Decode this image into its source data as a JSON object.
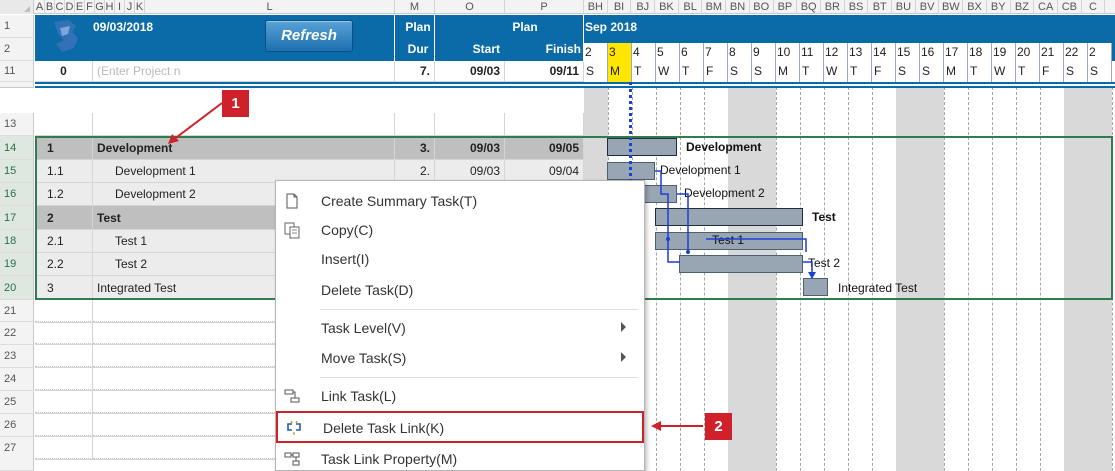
{
  "column_letters": [
    "A",
    "B",
    "C",
    "D",
    "E",
    "F",
    "G",
    "H",
    "I",
    "J",
    "K",
    "L",
    "M",
    "O",
    "P",
    "BH",
    "BI",
    "BJ",
    "BK",
    "BL",
    "BM",
    "BN",
    "BO",
    "BP",
    "BQ",
    "BR",
    "BS",
    "BT",
    "BU",
    "BV",
    "BW",
    "BX",
    "BY",
    "BZ",
    "CA",
    "CB",
    "C"
  ],
  "row_numbers": [
    "1",
    "2",
    "11",
    "13",
    "14",
    "15",
    "16",
    "17",
    "18",
    "19",
    "20",
    "21",
    "22",
    "23",
    "24",
    "25",
    "26",
    "27"
  ],
  "header": {
    "date": "09/03/2018",
    "refresh_label": "Refresh",
    "plan_label": "Plan",
    "dur_label": "Dur",
    "plan_group_label": "Plan",
    "start_label": "Start",
    "finish_label": "Finish",
    "month_label": "Sep 2018",
    "day_numbers": [
      "2",
      "3",
      "4",
      "5",
      "6",
      "7",
      "8",
      "9",
      "10",
      "11",
      "12",
      "13",
      "14",
      "15",
      "16",
      "17",
      "18",
      "19",
      "20",
      "21",
      "22",
      "2"
    ],
    "weekday_letters": [
      "S",
      "M",
      "T",
      "W",
      "T",
      "F",
      "S",
      "S",
      "M",
      "T",
      "W",
      "T",
      "F",
      "S",
      "S",
      "M",
      "T",
      "W",
      "T",
      "F",
      "S",
      "S"
    ]
  },
  "project_row": {
    "id": "0",
    "name_placeholder": "(Enter Project n",
    "duration": "7.",
    "start": "09/03",
    "finish": "09/11"
  },
  "tasks": [
    {
      "id": "1",
      "name": "Development",
      "duration": "3.",
      "start": "09/03",
      "finish": "09/05",
      "summary": true
    },
    {
      "id": "1.1",
      "name": "Development 1",
      "duration": "2.",
      "start": "09/03",
      "finish": "09/04",
      "summary": false
    },
    {
      "id": "1.2",
      "name": "Development 2",
      "duration": "",
      "start": "",
      "finish": "",
      "summary": false
    },
    {
      "id": "2",
      "name": "Test",
      "duration": "",
      "start": "",
      "finish": "",
      "summary": true
    },
    {
      "id": "2.1",
      "name": "Test 1",
      "duration": "",
      "start": "",
      "finish": "",
      "summary": false
    },
    {
      "id": "2.2",
      "name": "Test 2",
      "duration": "",
      "start": "",
      "finish": "",
      "summary": false
    },
    {
      "id": "3",
      "name": "Integrated Test",
      "duration": "",
      "start": "",
      "finish": "",
      "summary": false
    }
  ],
  "gantt_labels": {
    "development": "Development",
    "development_1": "Development 1",
    "development_2": "Development 2",
    "test": "Test",
    "test_1": "Test 1",
    "test_2": "Test 2",
    "integrated_test": "Integrated Test"
  },
  "context_menu": {
    "items": [
      {
        "label": "Create Summary Task(T)",
        "icon": "page-icon",
        "submenu": false
      },
      {
        "label": "Copy(C)",
        "icon": "copy-icon",
        "submenu": false
      },
      {
        "label": "Insert(I)",
        "icon": "",
        "submenu": false
      },
      {
        "label": "Delete Task(D)",
        "icon": "",
        "submenu": false
      },
      {
        "label": "Task Level(V)",
        "icon": "",
        "submenu": true
      },
      {
        "label": "Move Task(S)",
        "icon": "",
        "submenu": true
      },
      {
        "label": "Link Task(L)",
        "icon": "link-task-icon",
        "submenu": false
      },
      {
        "label": "Delete Task Link(K)",
        "icon": "unlink-icon",
        "submenu": false,
        "highlighted": true
      },
      {
        "label": "Task Link Property(M)",
        "icon": "link-property-icon",
        "submenu": false
      }
    ]
  },
  "callouts": {
    "one": "1",
    "two": "2"
  },
  "colors": {
    "header_blue": "#0b6aa8",
    "today_yellow": "#ffe600",
    "callout_red": "#d0202a",
    "selection_green": "#2f7d4d"
  }
}
